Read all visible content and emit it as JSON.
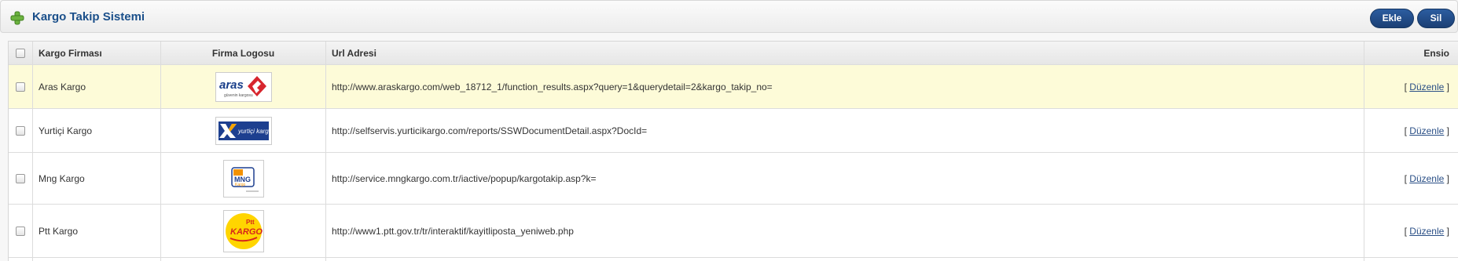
{
  "header": {
    "title": "Kargo Takip Sistemi",
    "add_label": "Ekle",
    "delete_label": "Sil"
  },
  "table": {
    "columns": [
      "Kargo Firması",
      "Firma Logosu",
      "Url Adresi",
      "Ensio"
    ],
    "rows": [
      {
        "firm": "Aras Kargo",
        "logo": "aras-logo",
        "url": "http://www.araskargo.com/web_18712_1/function_results.aspx?query=1&querydetail=2&kargo_takip_no=",
        "edit_open": "[",
        "edit": "Düzenle",
        "edit_close": "]",
        "logo_text": "aras",
        "logo_sub": "güvenin kargosu"
      },
      {
        "firm": "Yurtiçi Kargo",
        "logo": "yurtici-logo",
        "url": "http://selfservis.yurticikargo.com/reports/SSWDocumentDetail.aspx?DocId=",
        "edit_open": "[",
        "edit": "Düzenle",
        "edit_close": "]",
        "logo_text": "yurtiçi kargo"
      },
      {
        "firm": "Mng Kargo",
        "logo": "mng-logo",
        "url": "http://service.mngkargo.com.tr/iactive/popup/kargotakip.asp?k=",
        "edit_open": "[",
        "edit": "Düzenle",
        "edit_close": "]",
        "logo_text": "MNG",
        "logo_sub": "Kargo"
      },
      {
        "firm": "Ptt Kargo",
        "logo": "ptt-logo",
        "url": "http://www1.ptt.gov.tr/tr/interaktif/kayitliposta_yeniweb.php",
        "edit_open": "[",
        "edit": "Düzenle",
        "edit_close": "]",
        "logo_text": "KARGO",
        "logo_sub": "Ptt"
      }
    ]
  },
  "colors": {
    "accent": "#1a4f8a",
    "highlight_row": "#fdfbd8",
    "button": "#1b3f74"
  }
}
